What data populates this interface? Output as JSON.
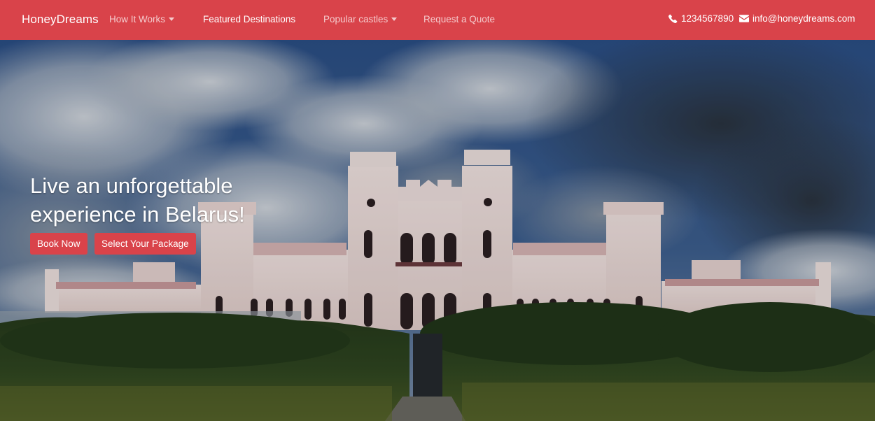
{
  "navbar": {
    "brand": "HoneyDreams",
    "items": [
      {
        "label": "How It Works",
        "has_dropdown": true
      },
      {
        "label": "Featured Destinations",
        "has_dropdown": false
      },
      {
        "label": "Popular castles",
        "has_dropdown": true
      },
      {
        "label": "Request a Quote",
        "has_dropdown": false
      }
    ],
    "phone": "1234567890",
    "email": "info@honeydreams.com",
    "phone_icon": "phone-icon",
    "email_icon": "envelope-icon"
  },
  "hero": {
    "headline": "Live an unforgettable experience in Belarus!",
    "buttons": {
      "book": "Book Now",
      "package": "Select Your Package"
    }
  },
  "colors": {
    "brand": "#d9434a",
    "nav_text": "#ffffff",
    "nav_text_muted": "rgba(255,255,255,0.72)"
  }
}
